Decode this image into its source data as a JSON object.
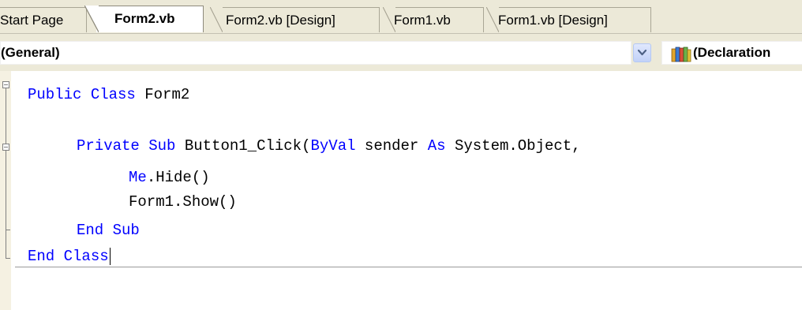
{
  "tabs": [
    {
      "label": "Start Page",
      "active": false
    },
    {
      "label": "Form2.vb",
      "active": true
    },
    {
      "label": "Form2.vb [Design]",
      "active": false
    },
    {
      "label": "Form1.vb",
      "active": false
    },
    {
      "label": "Form1.vb [Design]",
      "active": false
    }
  ],
  "navbar": {
    "class_combo_value": "(General)",
    "members_combo_value": "(Declaration",
    "dropdown_icon": "chevron-down-icon",
    "members_icon": "books-icon"
  },
  "code": {
    "line1": {
      "kw1": "Public",
      "kw2": "Class",
      "rest": "Form2"
    },
    "line3": {
      "kw1": "Private",
      "kw2": "Sub",
      "mid": "Button1_Click(",
      "kw3": "ByVal",
      "mid2": "sender",
      "kw4": "As",
      "rest": "System.Object,"
    },
    "line4": {
      "kw": "Me",
      "rest": ".Hide()"
    },
    "line5": {
      "rest": "Form1.Show()"
    },
    "line6": {
      "kw1": "End",
      "kw2": "Sub"
    },
    "line7": {
      "kw1": "End",
      "kw2": "Class"
    }
  },
  "colors": {
    "keyword": "#0000ff",
    "chrome": "#ece9d8"
  }
}
